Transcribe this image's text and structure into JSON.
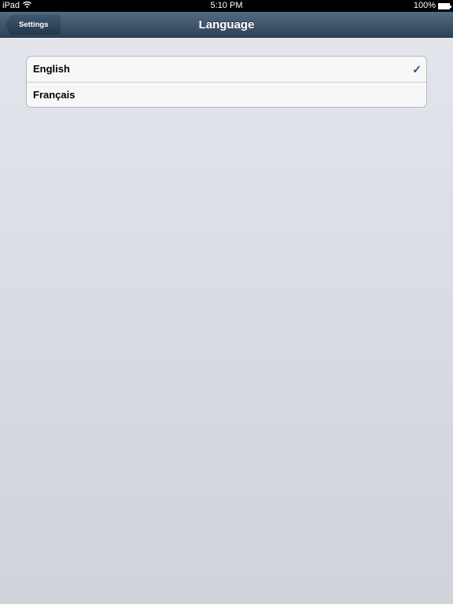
{
  "status": {
    "device": "iPad",
    "time": "5:10 PM",
    "battery": "100%"
  },
  "nav": {
    "back_label": "Settings",
    "title": "Language"
  },
  "languages": [
    {
      "label": "English",
      "selected": true,
      "check": "✓"
    },
    {
      "label": "Français",
      "selected": false
    }
  ]
}
